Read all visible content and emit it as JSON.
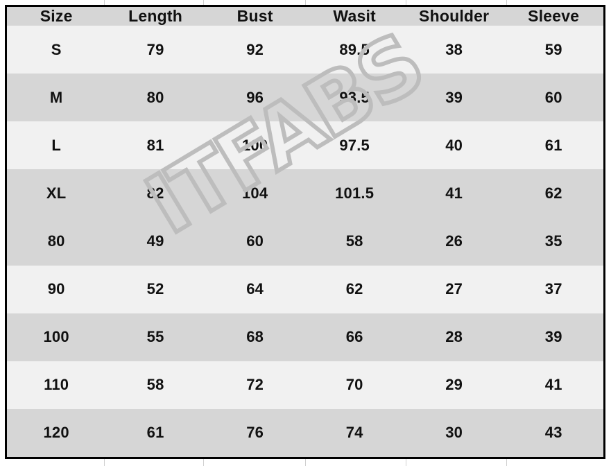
{
  "document": {
    "type": "size-chart-table",
    "watermark_text": "ITFABS",
    "border_color": "#000000",
    "row_dark_color": "#d6d6d6",
    "row_light_color": "#f1f1f1",
    "text_color": "#111111",
    "watermark_color": "#bdbdbd"
  },
  "table": {
    "headers": [
      "Size",
      "Length",
      "Bust",
      "Wasit",
      "Shoulder",
      "Sleeve"
    ],
    "rows": [
      {
        "shade": "light",
        "cells": [
          "S",
          "79",
          "92",
          "89.5",
          "38",
          "59"
        ]
      },
      {
        "shade": "dark",
        "cells": [
          "M",
          "80",
          "96",
          "93.5",
          "39",
          "60"
        ]
      },
      {
        "shade": "light",
        "cells": [
          "L",
          "81",
          "100",
          "97.5",
          "40",
          "61"
        ]
      },
      {
        "shade": "dark",
        "cells": [
          "XL",
          "82",
          "104",
          "101.5",
          "41",
          "62"
        ]
      },
      {
        "shade": "light",
        "cells": [
          "",
          "",
          "",
          "",
          "",
          ""
        ]
      },
      {
        "shade": "dark",
        "cells": [
          "80",
          "49",
          "60",
          "58",
          "26",
          "35"
        ]
      },
      {
        "shade": "light",
        "cells": [
          "90",
          "52",
          "64",
          "62",
          "27",
          "37"
        ]
      },
      {
        "shade": "dark",
        "cells": [
          "100",
          "55",
          "68",
          "66",
          "28",
          "39"
        ]
      },
      {
        "shade": "light",
        "cells": [
          "110",
          "58",
          "72",
          "70",
          "29",
          "41"
        ]
      },
      {
        "shade": "dark",
        "cells": [
          "120",
          "61",
          "76",
          "74",
          "30",
          "43"
        ]
      }
    ]
  },
  "sheet": {
    "gridline_positions": [
      150,
      293,
      440,
      585,
      730
    ]
  }
}
